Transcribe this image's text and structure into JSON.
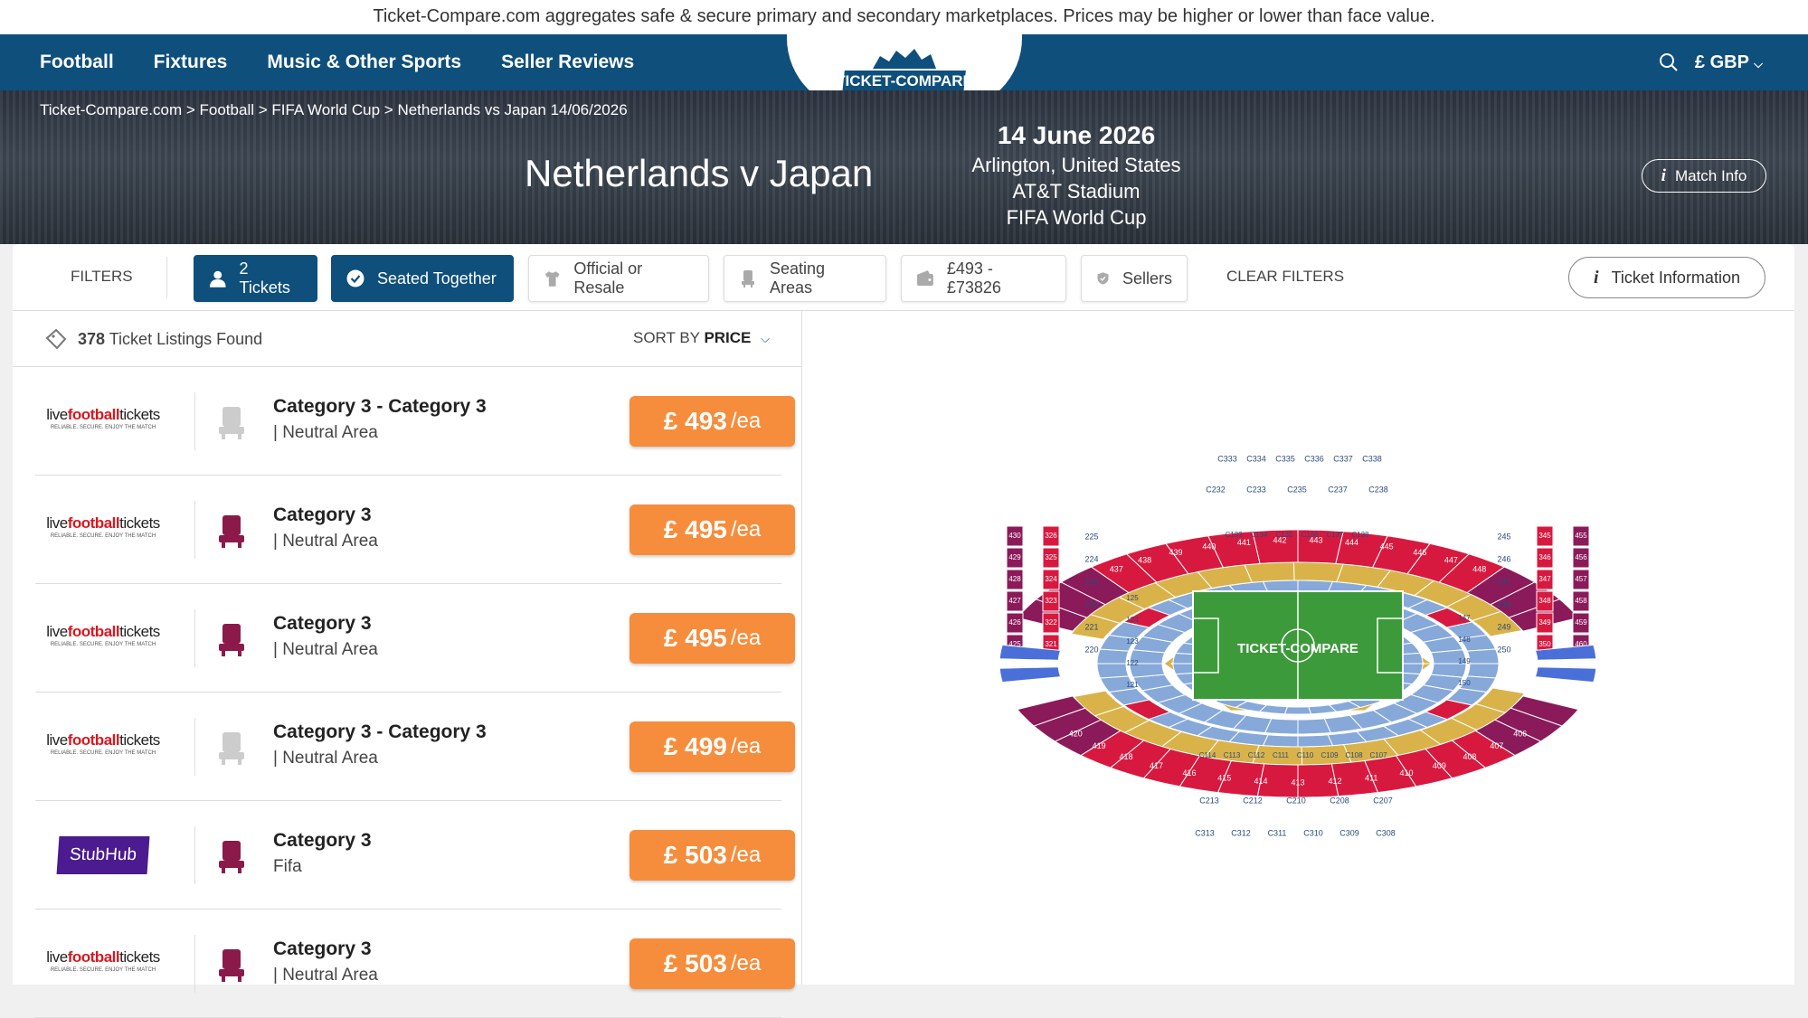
{
  "notice": "Ticket-Compare.com aggregates safe & secure primary and secondary marketplaces. Prices may be higher or lower than face value.",
  "nav": {
    "links": [
      "Football",
      "Fixtures",
      "Music & Other Sports",
      "Seller Reviews"
    ],
    "logo_text": "TICKET-COMPARE",
    "currency": "£ GBP"
  },
  "breadcrumb": {
    "home": "Ticket-Compare.com",
    "football": "Football",
    "competition": "FIFA World Cup",
    "current": "Netherlands vs Japan 14/06/2026"
  },
  "event": {
    "title": "Netherlands v Japan",
    "date": "14 June 2026",
    "city": "Arlington, United States",
    "venue": "AT&T Stadium",
    "competition": "FIFA World Cup",
    "match_info_label": "Match Info"
  },
  "filters": {
    "label": "FILTERS",
    "tickets": "2 Tickets",
    "seated_together": "Seated Together",
    "official_resale": "Official or Resale",
    "seating_areas": "Seating Areas",
    "price_range": "£493 - £73826",
    "sellers": "Sellers",
    "clear": "CLEAR FILTERS",
    "ticket_info": "Ticket Information"
  },
  "listings_header": {
    "count": "378",
    "count_suffix": "Ticket Listings Found",
    "sort_by": "SORT BY",
    "sort_value": "PRICE"
  },
  "listings": [
    {
      "seller": "livefootballtickets",
      "category": "Category 3 - Category 3",
      "area": "| Neutral Area",
      "price": "£ 493",
      "per": "/ea",
      "seat_color": "#cccccc"
    },
    {
      "seller": "livefootballtickets",
      "category": "Category 3",
      "area": "| Neutral Area",
      "price": "£ 495",
      "per": "/ea",
      "seat_color": "#8b1a4a"
    },
    {
      "seller": "livefootballtickets",
      "category": "Category 3",
      "area": "| Neutral Area",
      "price": "£ 495",
      "per": "/ea",
      "seat_color": "#8b1a4a"
    },
    {
      "seller": "livefootballtickets",
      "category": "Category 3 - Category 3",
      "area": "| Neutral Area",
      "price": "£ 499",
      "per": "/ea",
      "seat_color": "#cccccc"
    },
    {
      "seller": "StubHub",
      "category": "Category 3",
      "area": "Fifa",
      "price": "£ 503",
      "per": "/ea",
      "seat_color": "#8b1a4a"
    },
    {
      "seller": "livefootballtickets",
      "category": "Category 3",
      "area": "| Neutral Area",
      "price": "£ 503",
      "per": "/ea",
      "seat_color": "#8b1a4a"
    }
  ],
  "seller_logo": {
    "live": "live",
    "football": "football",
    "tickets": "tickets",
    "tagline": "RELIABLE. SECURE. ENJOY THE MATCH"
  },
  "stadium_map": {
    "pitch_logo": "TICKET-COMPARE",
    "colors": {
      "upper": "#d7193f",
      "upper_dark": "#8b1a5a",
      "club": "#d9b34a",
      "lower": "#86a9d9",
      "pitch": "#3d9a3a",
      "accent": "#4a6fd9"
    },
    "sections_upper_top": [
      "437",
      "438",
      "439",
      "440",
      "441",
      "442",
      "443",
      "444",
      "445",
      "446",
      "447",
      "448"
    ],
    "sections_upper_bottom": [
      "420",
      "419",
      "418",
      "417",
      "416",
      "415",
      "414",
      "413",
      "412",
      "411",
      "410",
      "409",
      "408",
      "407",
      "406"
    ],
    "sections_left_columns": [
      "430",
      "429",
      "428",
      "427",
      "426",
      "425"
    ],
    "sections_left_inner": [
      "326",
      "325",
      "324",
      "323",
      "322",
      "321"
    ],
    "sections_right_inner": [
      "345",
      "346",
      "347",
      "348",
      "349",
      "350"
    ],
    "sections_right_columns": [
      "455",
      "456",
      "457",
      "458",
      "459",
      "460"
    ],
    "sections_lower_left": [
      "225",
      "224",
      "223",
      "222",
      "221",
      "220"
    ],
    "sections_lower_right": [
      "245",
      "246",
      "247",
      "248",
      "249",
      "250"
    ],
    "sections_c_top": [
      "C333",
      "C334",
      "C335",
      "C336",
      "C337",
      "C338"
    ],
    "sections_c_bottom": [
      "C313",
      "C312",
      "C311",
      "C310",
      "C309",
      "C308"
    ],
    "sections_field_left": [
      "125",
      "124",
      "123",
      "122",
      "121"
    ],
    "sections_field_right": [
      "147",
      "148",
      "149",
      "150"
    ],
    "sections_c1_top": [
      "C133",
      "C134",
      "C135",
      "C136",
      "C137",
      "C138"
    ],
    "sections_c1_bottom": [
      "C114",
      "C113",
      "C112",
      "C111",
      "C110",
      "C109",
      "C108",
      "C107"
    ],
    "sections_c2_top": [
      "C232",
      "C233",
      "C235",
      "C237",
      "C238"
    ],
    "sections_c2_bottom": [
      "C213",
      "C212",
      "C210",
      "C208",
      "C207"
    ]
  }
}
